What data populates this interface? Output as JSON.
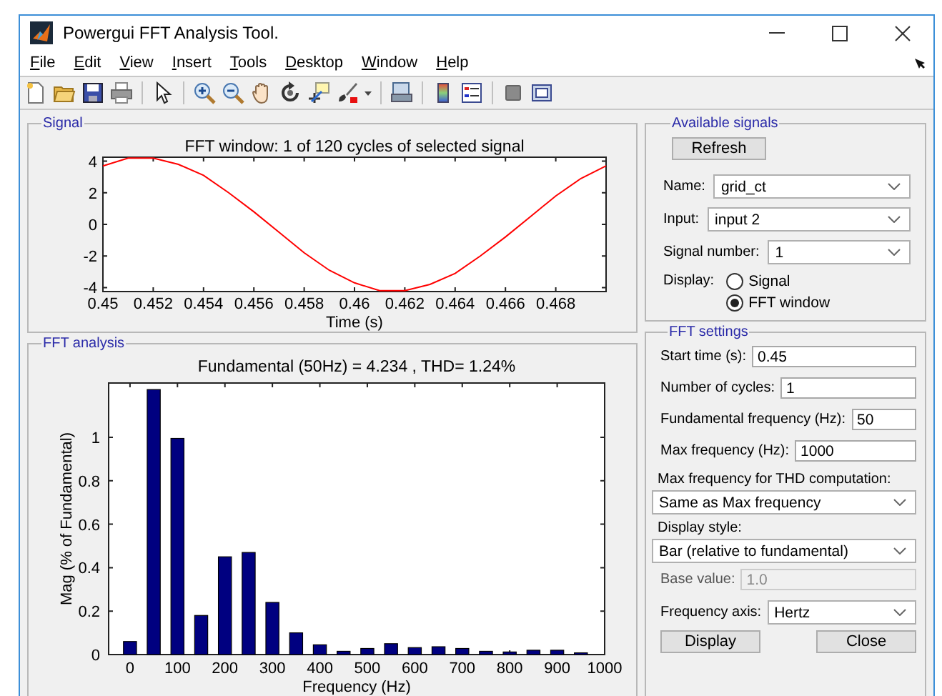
{
  "window": {
    "title": "Powergui FFT Analysis Tool."
  },
  "menu": [
    {
      "label": "File"
    },
    {
      "label": "Edit"
    },
    {
      "label": "View"
    },
    {
      "label": "Insert"
    },
    {
      "label": "Tools"
    },
    {
      "label": "Desktop"
    },
    {
      "label": "Window"
    },
    {
      "label": "Help"
    }
  ],
  "signal_panel": {
    "title": "Signal",
    "chart_data": {
      "type": "line",
      "title": "FFT window: 1 of 120 cycles of selected signal",
      "xlabel": "Time (s)",
      "x": [
        0.45,
        0.451,
        0.452,
        0.453,
        0.454,
        0.455,
        0.456,
        0.457,
        0.458,
        0.459,
        0.46,
        0.461,
        0.462,
        0.463,
        0.464,
        0.465,
        0.466,
        0.467,
        0.468,
        0.469,
        0.47
      ],
      "series": [
        {
          "color": "#ff0000",
          "values": [
            3.7,
            4.2,
            4.2,
            3.8,
            3.1,
            2,
            0.8,
            -0.5,
            -1.8,
            -2.9,
            -3.7,
            -4.2,
            -4.2,
            -3.8,
            -3.1,
            -2,
            -0.8,
            0.5,
            1.8,
            2.9,
            3.7
          ]
        }
      ],
      "xlim": [
        0.45,
        0.47
      ],
      "ylim": [
        -4.25,
        4.25
      ],
      "xticks": [
        0.45,
        0.452,
        0.454,
        0.456,
        0.458,
        0.46,
        0.462,
        0.464,
        0.466,
        0.468
      ],
      "yticks": [
        -4,
        -2,
        0,
        2,
        4
      ]
    }
  },
  "fft_panel": {
    "title": "FFT analysis",
    "chart_data": {
      "type": "bar",
      "title": "Fundamental (50Hz) = 4.234 , THD= 1.24%",
      "xlabel": "Frequency (Hz)",
      "ylabel": "Mag (% of Fundamental)",
      "x": [
        0,
        50,
        100,
        150,
        200,
        250,
        300,
        350,
        400,
        450,
        500,
        550,
        600,
        650,
        700,
        750,
        800,
        850,
        900,
        950
      ],
      "series": [
        {
          "color": "#000080",
          "values": [
            0.06,
            1.22,
            0.995,
            0.18,
            0.45,
            0.47,
            0.24,
            0.1,
            0.045,
            0.015,
            0.028,
            0.05,
            0.032,
            0.036,
            0.028,
            0.015,
            0.012,
            0.02,
            0.02,
            0.008
          ]
        }
      ],
      "xlim": [
        -45,
        1000
      ],
      "ylim": [
        0,
        1.25
      ],
      "xticks": [
        0,
        100,
        200,
        300,
        400,
        500,
        600,
        700,
        800,
        900,
        1000
      ],
      "yticks": [
        0,
        0.2,
        0.4,
        0.6,
        0.8,
        1
      ]
    }
  },
  "available_signals": {
    "title": "Available signals",
    "refresh_button": "Refresh",
    "fields": [
      {
        "label": "Name:",
        "value": "grid_ct"
      },
      {
        "label": "Input:",
        "value": "input 2"
      },
      {
        "label": "Signal number:",
        "value": "1"
      }
    ],
    "display": {
      "label": "Display:",
      "options": [
        {
          "label": "Signal",
          "selected": false
        },
        {
          "label": "FFT window",
          "selected": true
        }
      ]
    }
  },
  "fft_settings": {
    "title": "FFT settings",
    "items": [
      {
        "kind": "input",
        "label": "Start time (s):",
        "value": "0.45",
        "disabled": false
      },
      {
        "kind": "input",
        "label": "Number of cycles:",
        "value": "1",
        "disabled": false
      },
      {
        "kind": "input",
        "label": "Fundamental frequency (Hz):",
        "value": "50",
        "disabled": false
      },
      {
        "kind": "input",
        "label": "Max frequency (Hz):",
        "value": "1000",
        "disabled": false
      },
      {
        "kind": "stacked_select",
        "label": "Max frequency for THD computation:",
        "value": "Same as Max frequency"
      },
      {
        "kind": "stacked_select",
        "label": "Display style:",
        "value": "Bar (relative to fundamental)"
      },
      {
        "kind": "input",
        "label": "Base value:",
        "value": "1.0",
        "disabled": true
      },
      {
        "kind": "select",
        "label": "Frequency axis:",
        "value": "Hertz"
      }
    ],
    "buttons": [
      "Display",
      "Close"
    ]
  }
}
